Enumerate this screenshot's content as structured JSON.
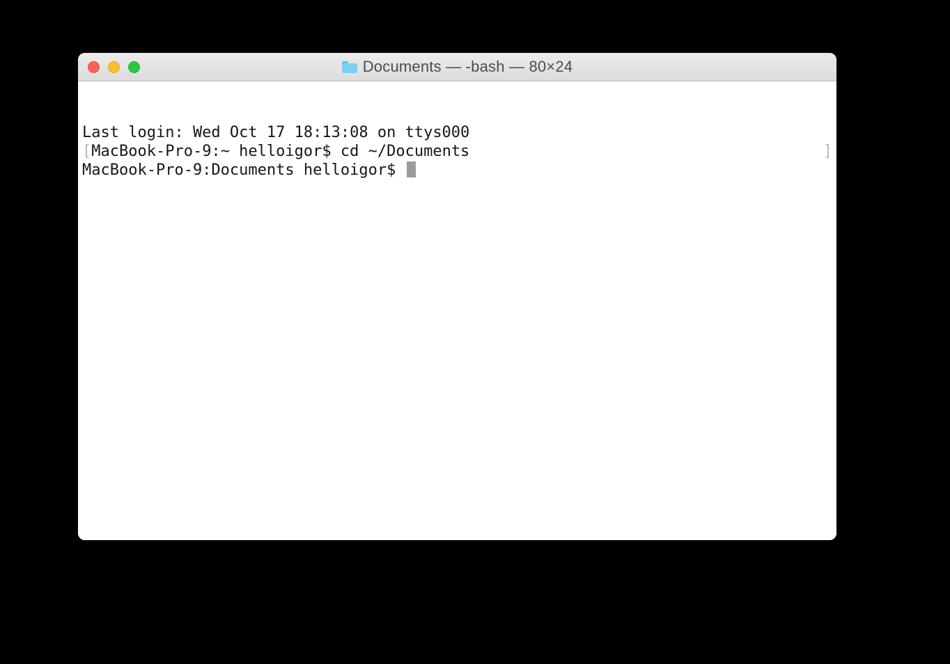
{
  "window": {
    "title": "Documents — -bash — 80×24"
  },
  "terminal": {
    "line1": "Last login: Wed Oct 17 18:13:08 on ttys000",
    "line2_prompt": "MacBook-Pro-9:~ helloigor$ ",
    "line2_cmd": "cd ~/Documents",
    "line3_prompt": "MacBook-Pro-9:Documents helloigor$ ",
    "left_bracket": "[",
    "right_bracket": "]"
  }
}
